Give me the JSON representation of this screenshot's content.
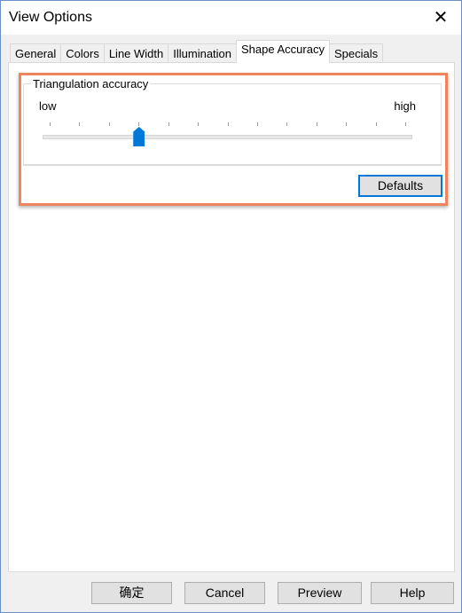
{
  "window": {
    "title": "View Options"
  },
  "tabs": [
    {
      "label": "General"
    },
    {
      "label": "Colors"
    },
    {
      "label": "Line Width"
    },
    {
      "label": "Illumination"
    },
    {
      "label": "Shape Accuracy",
      "active": true
    },
    {
      "label": "Specials"
    }
  ],
  "group": {
    "label": "Triangulation accuracy",
    "low_label": "low",
    "high_label": "high",
    "slider": {
      "min": 0,
      "max": 12,
      "value": 3,
      "ticks": 13,
      "accent": "#0078d7"
    }
  },
  "defaults_label": "Defaults",
  "buttons": {
    "ok": "确定",
    "cancel": "Cancel",
    "preview": "Preview",
    "help": "Help"
  },
  "highlight_color": "#f0845e"
}
